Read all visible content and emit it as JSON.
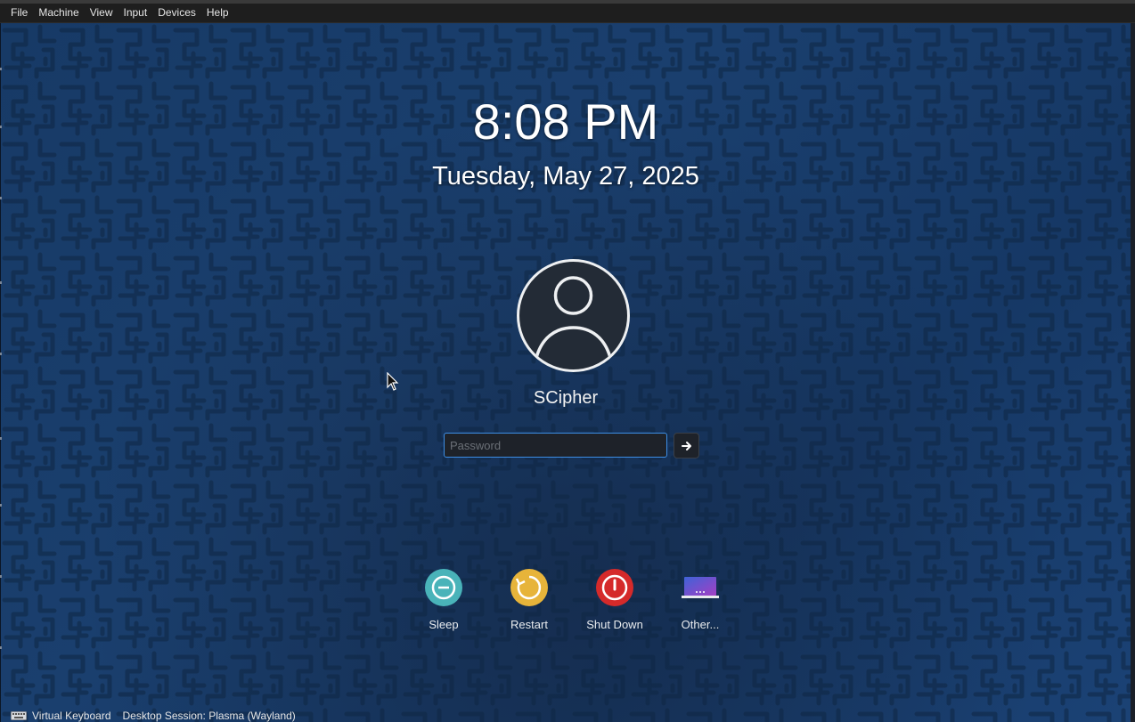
{
  "menubar": {
    "items": [
      "File",
      "Machine",
      "View",
      "Input",
      "Devices",
      "Help"
    ]
  },
  "lockscreen": {
    "time": "8:08 PM",
    "date": "Tuesday, May 27, 2025",
    "username": "SCipher",
    "password_placeholder": "Password"
  },
  "actions": [
    {
      "label": "Sleep",
      "icon": "sleep-icon",
      "color": "#49b3b9"
    },
    {
      "label": "Restart",
      "icon": "restart-icon",
      "color": "#e7b43a"
    },
    {
      "label": "Shut Down",
      "icon": "power-icon",
      "color": "#d52a2a"
    },
    {
      "label": "Other...",
      "icon": "laptop-icon",
      "color": "#5a4fc4"
    }
  ],
  "bottombar": {
    "virtual_keyboard": "Virtual Keyboard",
    "session": "Desktop Session: Plasma (Wayland)"
  },
  "colors": {
    "background": "#173a66",
    "input_focus_border": "#3d8ee6"
  }
}
